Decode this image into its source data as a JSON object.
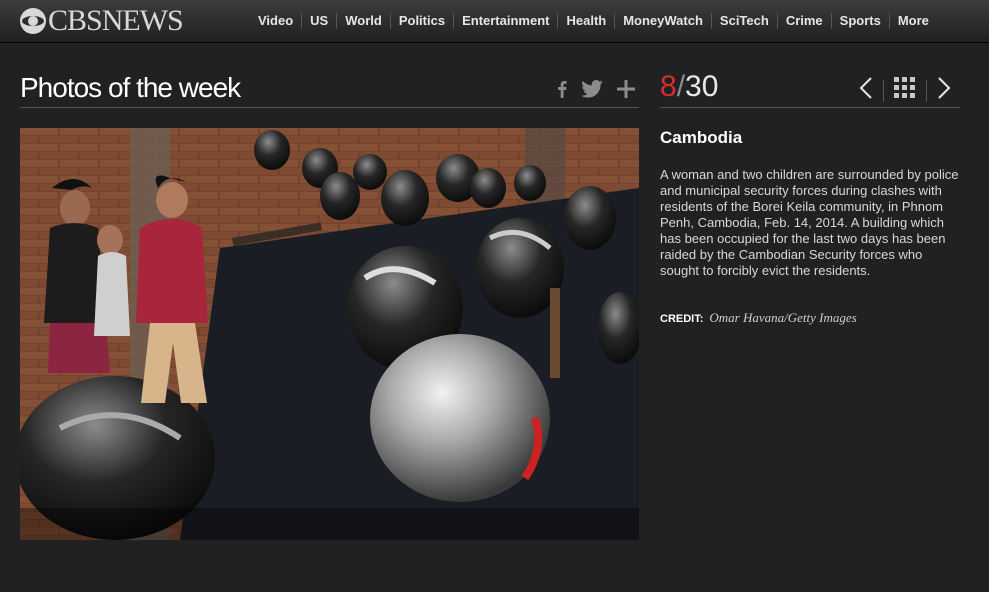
{
  "brand": {
    "logo_text": "CBSNEWS"
  },
  "nav": {
    "items": [
      "Video",
      "US",
      "World",
      "Politics",
      "Entertainment",
      "Health",
      "MoneyWatch",
      "SciTech",
      "Crime",
      "Sports",
      "More"
    ]
  },
  "gallery": {
    "title": "Photos of the week",
    "share_icons": [
      "facebook-icon",
      "twitter-icon",
      "plus-icon"
    ],
    "current": "8",
    "separator": "/",
    "total": "30"
  },
  "slide": {
    "headline": "Cambodia",
    "caption": "A woman and two children are surrounded by police and municipal security forces during clashes with residents of  the Borei Keila community, in Phnom Penh, Cambodia, Feb. 14, 2014. A building which has been occupied for the last two days has been raided by the Cambodian Security forces who sought to forcibly evict the residents.",
    "credit_label": "CREDIT:",
    "credit_value": "Omar Havana/Getty Images"
  },
  "colors": {
    "accent_red": "#d62d2d",
    "background": "#1f2122"
  }
}
